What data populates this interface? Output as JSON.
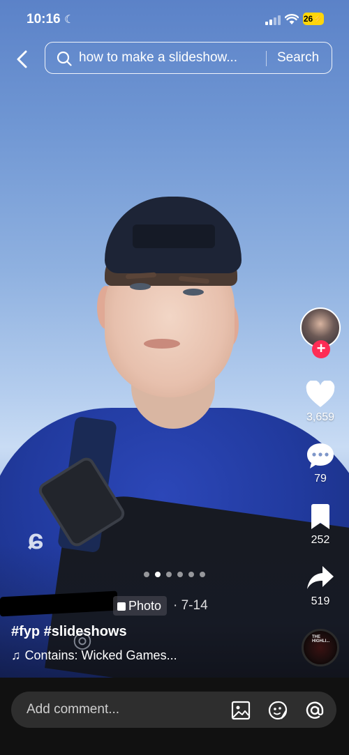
{
  "status_bar": {
    "time": "10:16",
    "battery": "26"
  },
  "search": {
    "query": "how to make a slideshow...",
    "button_label": "Search"
  },
  "actions": {
    "like_count": "3,659",
    "comment_count": "79",
    "bookmark_count": "252",
    "share_count": "519"
  },
  "post": {
    "type_label": "Photo",
    "date": "· 7-14",
    "hashtags": "#fyp #slideshows",
    "sound": "Contains: Wicked Games...",
    "disc_label": "THE HIGHLI..."
  },
  "carousel": {
    "total": 6,
    "active_index": 1
  },
  "comment": {
    "placeholder": "Add comment..."
  },
  "colors": {
    "follow_accent": "#fe2c55",
    "battery": "#ffd60a"
  }
}
